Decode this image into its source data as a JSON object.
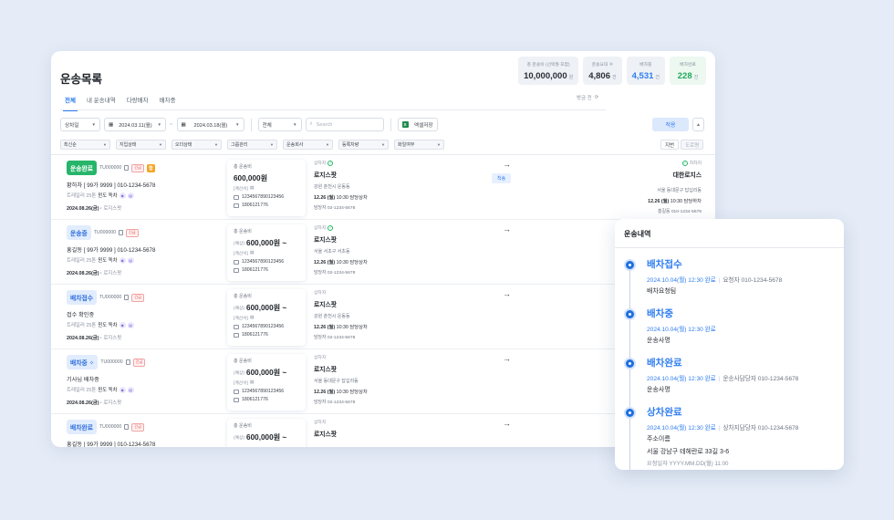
{
  "page": {
    "title": "운송목록"
  },
  "stats": [
    {
      "label": "총 운송비 (선택월 포함)",
      "value": "10,000,000",
      "unit": "원",
      "tone": "gray"
    },
    {
      "label": "운송요대 수",
      "value": "4,806",
      "unit": "건",
      "tone": "gray"
    },
    {
      "label": "배차중",
      "value": "4,531",
      "unit": "건",
      "tone": "blue"
    },
    {
      "label": "배차완료",
      "value": "228",
      "unit": "건",
      "tone": "green"
    }
  ],
  "tabs": [
    "전체",
    "내 운송내역",
    "다량배차",
    "배차중"
  ],
  "refresh_label": "방금 전",
  "filters": {
    "status_select": "상차일",
    "date_from": "2024.03.11(월)",
    "date_sep": "~",
    "date_to": "2024.03.18(월)",
    "all_select": "전체",
    "search_placeholder": "Search",
    "excel_label": "엑셀저장",
    "apply_label": "적용",
    "chips": [
      "최신순",
      "지입상태",
      "오더상태",
      "그룹관리",
      "운송회사",
      "등록차량",
      "화일여부"
    ],
    "view_toggle": [
      "지번",
      "도로명"
    ]
  },
  "rows": [
    {
      "status": "운송완료",
      "status_tone": "green",
      "tu_id": "TU000000",
      "urgent": "긴급",
      "extra_tag": "합",
      "driver": "황하차 [ 99가 9999 ] 010-1234-5678",
      "truck_type": "트레일러 25톤",
      "truck_kind": "윈도 독차",
      "date": "2024.08.26(금)",
      "company": "로지스팟",
      "fee_label": "총 운송비",
      "fee_prefix": "",
      "fee": "600,000원",
      "calc_label": "[계산서]",
      "account": "1234567890123456",
      "phone": "1806121776",
      "load_label": "상차지",
      "load_place": "로지스팟",
      "load_addr": "강원 춘천시 운동동",
      "load_time": "12.26 (월)",
      "load_time_rest": "10:30 담당상차",
      "load_mgr": "담당자",
      "load_mgr_phone": "02-1234-5678",
      "pill": "착송",
      "unload_label": "하차지",
      "unload_place": "대한로지스",
      "unload_addr": "서울 동대문구 답십리동",
      "unload_time": "12.26 (월)",
      "unload_time_rest": "10:30 담당하차",
      "unload_mgr": "홍길동",
      "unload_mgr_phone": "010-1234-5678"
    },
    {
      "status": "운송중",
      "status_tone": "blue",
      "tu_id": "TU000000",
      "urgent": "긴급",
      "extra_tag": "",
      "driver": "홍길동 [ 99가 9999 ] 010-1234-5678",
      "truck_type": "트레일러 25톤",
      "truck_kind": "윈도 독차",
      "date": "2024.08.26(금)",
      "company": "로지스팟",
      "fee_label": "총 운송비",
      "fee_prefix": "(예상)",
      "fee": "600,000원 ~",
      "calc_label": "[계산서]",
      "account": "1234567890123456",
      "phone": "1806121776",
      "load_label": "상차지",
      "load_place": "로지스팟",
      "load_addr": "서울 서초구 서초동",
      "load_time": "12.26 (월)",
      "load_time_rest": "10:30 담당상차",
      "load_mgr": "담당자",
      "load_mgr_phone": "02-1234-5678"
    },
    {
      "status": "배차접수",
      "status_tone": "blue",
      "tu_id": "TU000000",
      "urgent": "긴급",
      "extra_tag": "",
      "driver": "접수 확인중",
      "truck_type": "트레일러 25톤",
      "truck_kind": "윈도 독차",
      "date": "2024.08.26(금)",
      "company": "로지스팟",
      "fee_label": "총 운송비",
      "fee_prefix": "(예상)",
      "fee": "600,000원 ~",
      "calc_label": "[계산서]",
      "account": "1234567890123456",
      "phone": "1806121776",
      "load_label": "상차지",
      "load_place": "로지스팟",
      "load_addr": "강원 춘천시 운동동",
      "load_time": "12.26 (월)",
      "load_time_rest": "10:30 담당상차",
      "load_mgr": "담당자",
      "load_mgr_phone": "02-1234-5678"
    },
    {
      "status": "배차중",
      "status_tone": "blue",
      "tu_id": "TU000000",
      "urgent": "긴급",
      "extra_tag": "",
      "driver": "기사님 배차중",
      "truck_type": "트레일러 25톤",
      "truck_kind": "윈도 독차",
      "date": "2024.08.26(금)",
      "company": "로지스팟",
      "fee_label": "총 운송비",
      "fee_prefix": "(예상)",
      "fee": "600,000원 ~",
      "calc_label": "[계산서]",
      "account": "1234567890123456",
      "phone": "1806121776",
      "load_label": "상차지",
      "load_place": "로지스팟",
      "load_addr": "서울 동대문구 답십리동",
      "load_time": "12.26 (월)",
      "load_time_rest": "10:30 담당상차",
      "load_mgr": "담당자",
      "load_mgr_phone": "02-1234-5678"
    },
    {
      "status": "배차완료",
      "status_tone": "blue",
      "tu_id": "TU000000",
      "urgent": "긴급",
      "extra_tag": "",
      "driver": "홍길동 [ 99가 9999 ] 010-1234-5678",
      "truck_type": "",
      "truck_kind": "",
      "date": "",
      "company": "",
      "fee_label": "총 운송비",
      "fee_prefix": "(예상)",
      "fee": "600,000원 ~",
      "calc_label": "",
      "account": "",
      "phone": "",
      "load_label": "상차지",
      "load_place": "로지스팟",
      "load_addr": "",
      "load_time": "",
      "load_time_rest": "",
      "load_mgr": "",
      "load_mgr_phone": ""
    }
  ],
  "detail": {
    "title": "운송내역",
    "events": [
      {
        "title": "배차접수",
        "meta": "2024.10.04(월) 12:30 완료",
        "extra": "요청자 010-1234-5678",
        "name": "배차요청팀"
      },
      {
        "title": "배차중",
        "meta": "2024.10.04(월) 12:30 완료",
        "extra": "",
        "name": "운송사명"
      },
      {
        "title": "배차완료",
        "meta": "2024.10.04(월) 12:30 완료",
        "extra": "운송사담당자 010-1234-5678",
        "name": "운송사명"
      },
      {
        "title": "상차완료",
        "meta": "2024.10.04(월) 12:30 완료",
        "extra": "상차지담당자 010-1234-5678",
        "name": "주소이름",
        "addr": "서울 강남구 테헤란로 33길 3-6",
        "req_label": "요청일자",
        "req_value": "YYYY.MM.DD(월) 11:00"
      }
    ]
  },
  "colors": {
    "accent": "#2f7df0",
    "success": "#27b56a",
    "urgent": "#e24b4b",
    "background": "#e5ecf7"
  }
}
